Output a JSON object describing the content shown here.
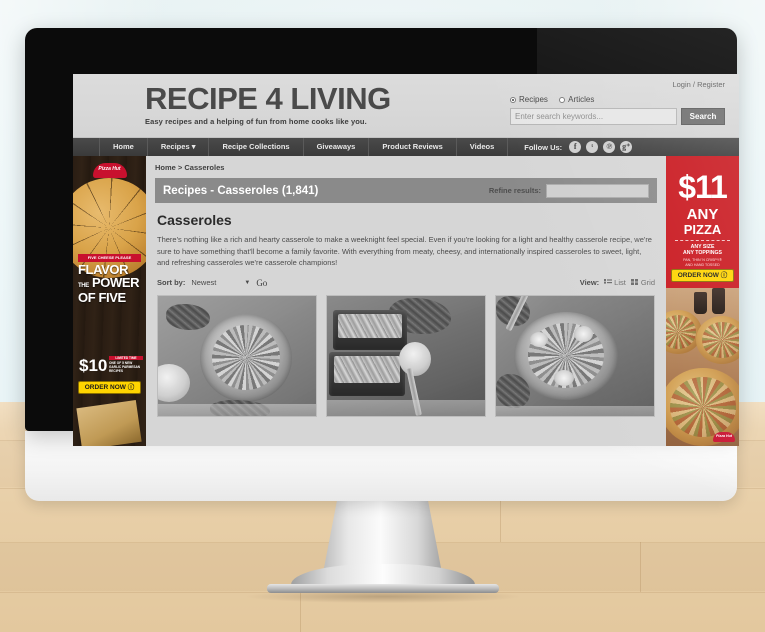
{
  "site": {
    "logo_main": "RECIPE 4 LIVING",
    "logo_tagline": "Easy recipes and a helping of fun from home cooks like you.",
    "login_register": "Login / Register"
  },
  "search": {
    "radio_recipes": "Recipes",
    "radio_articles": "Articles",
    "selected_radio": "Recipes",
    "placeholder": "Enter search keywords...",
    "value": "",
    "button": "Search"
  },
  "nav": {
    "items": [
      {
        "label": "Home"
      },
      {
        "label": "Recipes ▾"
      },
      {
        "label": "Recipe Collections"
      },
      {
        "label": "Giveaways"
      },
      {
        "label": "Product Reviews"
      },
      {
        "label": "Videos"
      }
    ],
    "follow_label": "Follow Us:",
    "social": [
      {
        "name": "facebook",
        "glyph": "f"
      },
      {
        "name": "twitter",
        "glyph": "ᵗ"
      },
      {
        "name": "pinterest",
        "glyph": "℗"
      },
      {
        "name": "googleplus",
        "glyph": "g⁺"
      }
    ]
  },
  "breadcrumb": "Home > Casseroles",
  "listing": {
    "title_bar": "Recipes - Casseroles (1,841)",
    "refine_label": "Refine results:",
    "refine_value": "",
    "heading": "Casseroles",
    "description": "There's nothing like a rich and hearty casserole to make a weeknight feel special. Even if you're looking for a light and healthy casserole recipe, we're sure to have something that'll become a family favorite. With everything from meaty, cheesy, and internationally inspired casseroles to sweet, light, and refreshing casseroles we're casserole champions!",
    "sort_label": "Sort by:",
    "sort_value": "Newest",
    "go_label": "Go",
    "view_label": "View:",
    "view_list": "List",
    "view_grid": "Grid"
  },
  "thumbs": [
    {
      "alt": "casserole-in-white-pot"
    },
    {
      "alt": "casserole-in-black-baking-dishes"
    },
    {
      "alt": "casserole-with-lemon-in-skillet"
    }
  ],
  "ad_left": {
    "brand": "Pizza Hut",
    "badge": "FIVE CHEESE PLEASE",
    "headline_1": "FLAVOR",
    "headline_small": "THE",
    "headline_2": "POWER",
    "headline_3": "OF FIVE",
    "price": "$10",
    "terms_head": "LIMITED TIME",
    "terms_body": "ONE OF 5 NEW GARLIC PARMESAN RECIPES",
    "cta": "ORDER NOW ⓘ"
  },
  "ad_right": {
    "price": "$11",
    "line_any": "ANY",
    "line_pizza": "PIZZA",
    "sub": "ANY SIZE\nANY TOPPINGS",
    "sub2": "PAN, THIN 'N CRISPY®\nAND HAND TOSSED",
    "cta": "ORDER NOW ⓘ",
    "brand": "Pizza Hut"
  },
  "colors": {
    "nav_bg": "#3a3a3a",
    "title_bar": "#8a8a8a",
    "ad_red": "#c9171e",
    "cta_yellow": "#ffd400"
  }
}
